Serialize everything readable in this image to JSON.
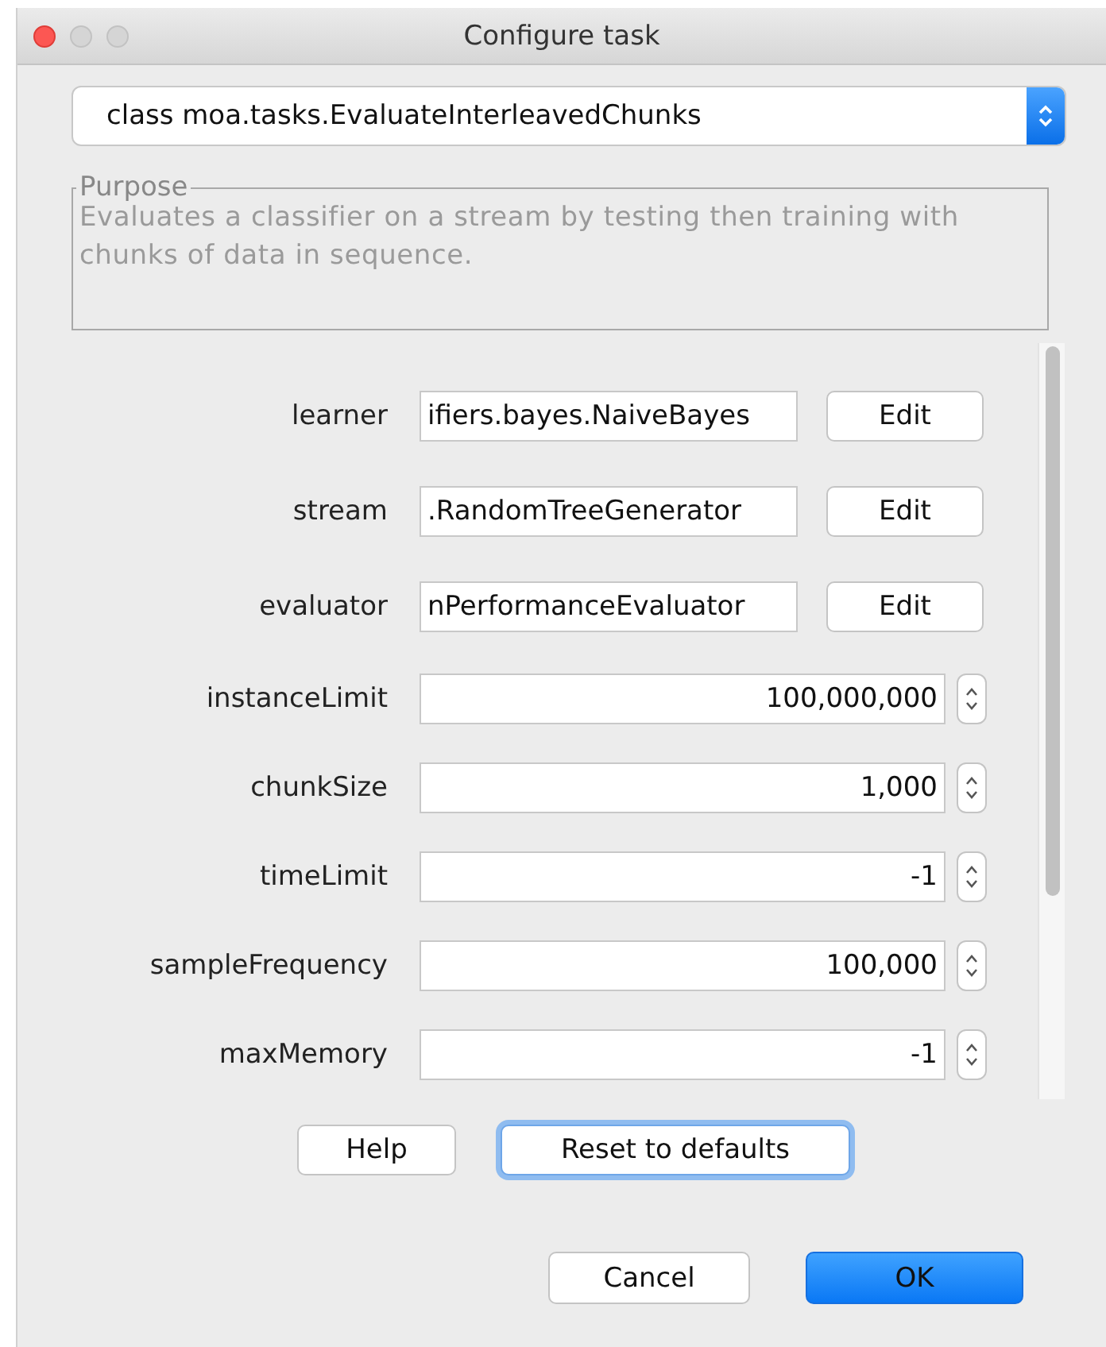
{
  "window": {
    "title": "Configure task"
  },
  "task_selector": {
    "value": "class moa.tasks.EvaluateInterleavedChunks"
  },
  "purpose": {
    "legend": "Purpose",
    "text": "Evaluates a classifier on a stream by testing then training with chunks of data in sequence."
  },
  "options": [
    {
      "kind": "object",
      "label": "learner",
      "value": "ifiers.bayes.NaiveBayes",
      "button": "Edit"
    },
    {
      "kind": "object",
      "label": "stream",
      "value": ".RandomTreeGenerator",
      "button": "Edit"
    },
    {
      "kind": "object",
      "label": "evaluator",
      "value": "nPerformanceEvaluator",
      "button": "Edit"
    },
    {
      "kind": "number",
      "label": "instanceLimit",
      "value": "100,000,000"
    },
    {
      "kind": "number",
      "label": "chunkSize",
      "value": "1,000"
    },
    {
      "kind": "number",
      "label": "timeLimit",
      "value": "-1"
    },
    {
      "kind": "number",
      "label": "sampleFrequency",
      "value": "100,000"
    },
    {
      "kind": "number",
      "label": "maxMemory",
      "value": "-1"
    }
  ],
  "option_buttons": [
    {
      "label": "Help",
      "focused": false
    },
    {
      "label": "Reset to defaults",
      "focused": true
    }
  ],
  "dialog_buttons": [
    {
      "label": "Cancel",
      "default": false
    },
    {
      "label": "OK",
      "default": true
    }
  ]
}
